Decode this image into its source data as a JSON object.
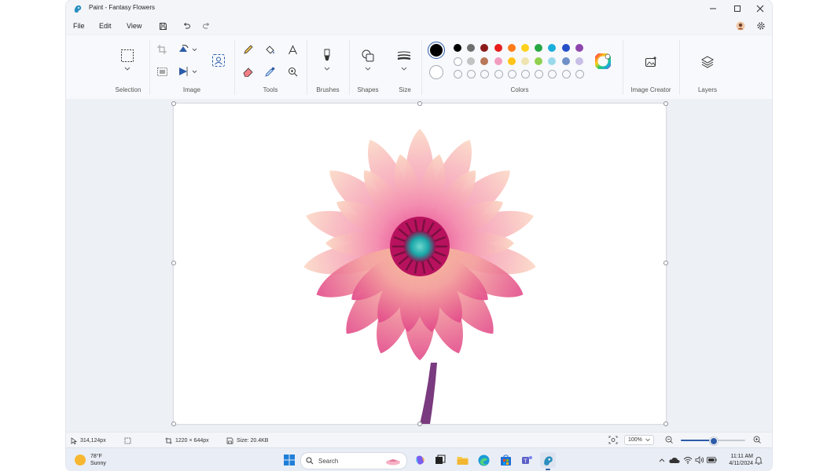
{
  "window": {
    "title": "Paint - Fantasy Flowers"
  },
  "menu": {
    "file": "File",
    "edit": "Edit",
    "view": "View"
  },
  "ribbon": {
    "groups": {
      "selection": "Selection",
      "image": "Image",
      "tools": "Tools",
      "brushes": "Brushes",
      "shapes": "Shapes",
      "size": "Size",
      "colors": "Colors",
      "image_creator": "Image Creator",
      "layers": "Layers"
    },
    "colors": {
      "primary": "#000000",
      "secondary": "#ffffff",
      "palette_row1": [
        "#000000",
        "#6e6e6e",
        "#8b1a1a",
        "#e81f1f",
        "#ff7b1a",
        "#ffd21a",
        "#28a745",
        "#1aaedc",
        "#2650c8",
        "#8e44ad"
      ],
      "palette_row2": [
        "#ffffff",
        "#c3c3c3",
        "#b9785a",
        "#f39bbf",
        "#ffc418",
        "#efe4b0",
        "#8fd14f",
        "#99d9ea",
        "#6f8fc8",
        "#c8bfe7"
      ]
    }
  },
  "status": {
    "cursor_pos": "314,124px",
    "canvas_size": "1220 × 644px",
    "file_size": "Size: 20.4KB",
    "zoom": "100%",
    "zoom_level": 0.5
  },
  "taskbar": {
    "weather": {
      "temp": "78°F",
      "condition": "Sunny"
    },
    "search_placeholder": "Search",
    "clock": {
      "time": "11:11 AM",
      "date": "4/11/2024"
    }
  }
}
